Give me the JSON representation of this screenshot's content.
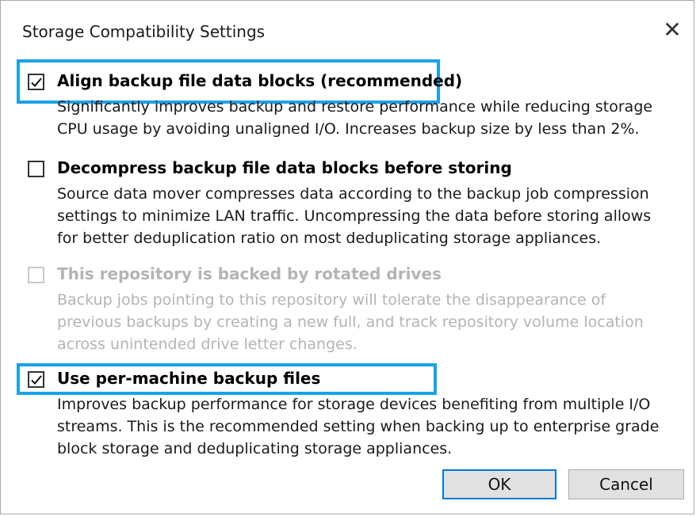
{
  "dialog": {
    "title": "Storage Compatibility Settings",
    "close_glyph": "✕"
  },
  "options": [
    {
      "label": "Align backup file data blocks (recommended)",
      "checked": true,
      "enabled": true,
      "highlighted": true,
      "description": "Significantly improves backup and restore performance while reducing storage\nCPU usage by avoiding unaligned I/O. Increases backup size by less than 2%."
    },
    {
      "label": "Decompress backup file data blocks before storing",
      "checked": false,
      "enabled": true,
      "highlighted": false,
      "description": "Source data mover compresses data according to the backup job compression\nsettings to minimize LAN traffic. Uncompressing the data before storing allows\nfor better deduplication ratio on most deduplicating storage appliances."
    },
    {
      "label": "This repository is backed by rotated drives",
      "checked": false,
      "enabled": false,
      "highlighted": false,
      "description": "Backup jobs pointing to this repository will tolerate the disappearance of\nprevious backups by creating a new full, and track repository volume location\nacross unintended drive letter changes."
    },
    {
      "label": "Use per-machine backup files",
      "checked": true,
      "enabled": true,
      "highlighted": true,
      "description": "Improves backup performance for storage devices benefiting from multiple I/O\nstreams. This is the recommended setting when backing up to enterprise grade\nblock storage and deduplicating storage appliances."
    }
  ],
  "buttons": {
    "ok": "OK",
    "cancel": "Cancel"
  },
  "colors": {
    "highlight": "#1aa2e8",
    "primary_border": "#0078d7",
    "disabled_text": "#b4b4b4"
  },
  "icons": {
    "checked": "checkmark-icon",
    "close": "close-icon"
  }
}
